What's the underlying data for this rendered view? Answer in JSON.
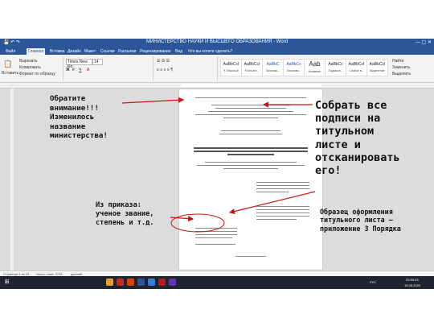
{
  "window": {
    "title": "МИНИСТЕРСТВО НАУКИ И ВЫСШЕГО ОБРАЗОВАНИЯ - Word"
  },
  "ribbon": {
    "tabs": [
      "Файл",
      "Главная",
      "Вставка",
      "Дизайн",
      "Макет",
      "Ссылки",
      "Рассылки",
      "Рецензирование",
      "Вид",
      "Что вы хотите сделать?"
    ],
    "active_tab_index": 1,
    "clipboard": {
      "paste": "Вставить",
      "cut": "Вырезать",
      "copy": "Копировать",
      "format_painter": "Формат по образцу"
    },
    "font": {
      "name": "Times New Ro",
      "size": "14"
    },
    "styles": [
      {
        "sample": "AaBbCcI",
        "name": "¶ Обычный"
      },
      {
        "sample": "AaBbCcI",
        "name": "¶ Без инт..."
      },
      {
        "sample": "AaBbC",
        "name": "Заголово..."
      },
      {
        "sample": "AaBbCc",
        "name": "Заголово..."
      },
      {
        "sample": "Aab",
        "name": "Название"
      },
      {
        "sample": "AaBbCc",
        "name": "Подзагол..."
      },
      {
        "sample": "AaBbCcI",
        "name": "Слабое в..."
      },
      {
        "sample": "AaBbCcI",
        "name": "Выделение"
      }
    ],
    "editing": {
      "find": "Найти",
      "replace": "Заменить",
      "select": "Выделить"
    }
  },
  "status_bar": {
    "page": "Страница 1 из 19",
    "words": "Число слов: 2743",
    "language": "русский"
  },
  "taskbar": {
    "lang": "РУС",
    "time": "22:50:43",
    "date": "15.06.2020"
  },
  "annotations": {
    "left": "Обратите\nвнимание!!!\nИзменилось\nназвание\nминистерства!",
    "right": "Собрать все\nподписи на\nтитульном\nлисте и\nотсканировать\nего!",
    "middle": "Из приказа:\nученое звание,\nстепень и т.д.",
    "bottom_right": "Образец оформления\nтитульного листа –\nприложение 3 Порядка"
  },
  "colors": {
    "titlebar": "#2b579a",
    "taskbar": "#1e2430",
    "arrow": "#cc1111"
  }
}
